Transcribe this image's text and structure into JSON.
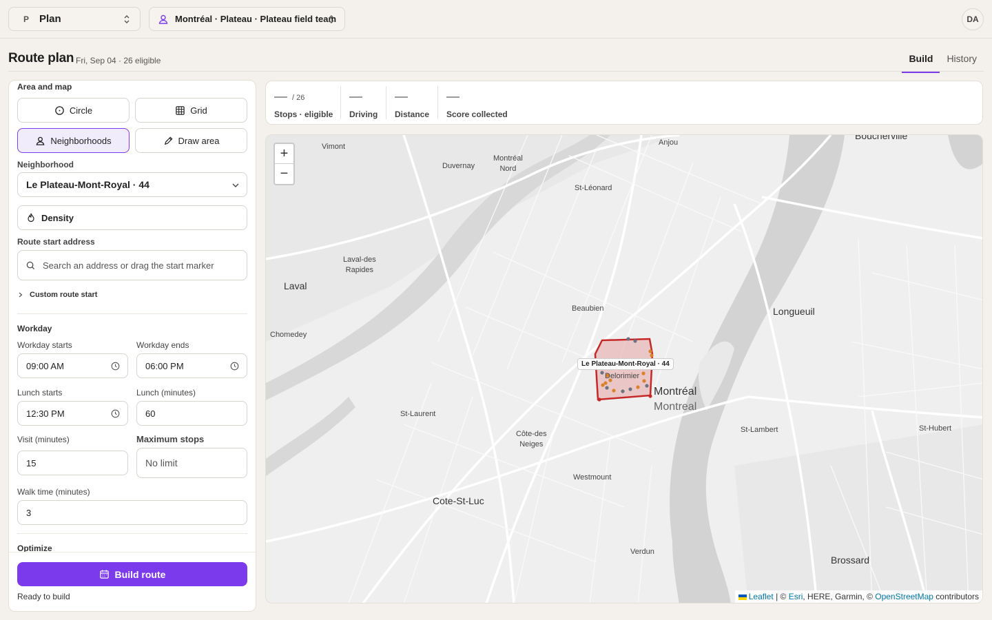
{
  "topbar": {
    "plan_badge": "P",
    "plan_label": "Plan",
    "team_label": "Montréal · Plateau · Plateau field team",
    "avatar": "DA"
  },
  "header": {
    "title": "Route plan",
    "subtitle": "Fri, Sep 04 · 26 eligible",
    "tabs": [
      {
        "label": "Build",
        "active": true
      },
      {
        "label": "History",
        "active": false
      }
    ]
  },
  "panel": {
    "area_label": "Area and map",
    "modes": {
      "circle": "Circle",
      "grid": "Grid",
      "neighborhoods": "Neighborhoods",
      "draw": "Draw area",
      "active": "neighborhoods"
    },
    "neighborhood_label": "Neighborhood",
    "neighborhood_value": "Le Plateau-Mont-Royal · 44",
    "density_label": "Density",
    "start_label": "Route start address",
    "start_placeholder": "Search an address or drag the start marker",
    "custom_start": "Custom route start",
    "workday_label": "Workday",
    "workday_starts_label": "Workday starts",
    "workday_starts": "09:00  AM",
    "workday_ends_label": "Workday ends",
    "workday_ends": "06:00  PM",
    "lunch_starts_label": "Lunch starts",
    "lunch_starts": "12:30  PM",
    "lunch_minutes_label": "Lunch (minutes)",
    "lunch_minutes": "60",
    "visit_label": "Visit (minutes)",
    "visit_value": "15",
    "max_stops_label": "Maximum stops",
    "max_stops_placeholder": "No limit",
    "walk_label": "Walk time (minutes)",
    "walk_value": "3",
    "optimize_label": "Optimize",
    "build_button": "Build route",
    "status": "Ready to build"
  },
  "stats": [
    {
      "value": "—",
      "of": "/ 26",
      "label": "Stops · eligible"
    },
    {
      "value": "—",
      "label": "Driving"
    },
    {
      "value": "—",
      "label": "Distance"
    },
    {
      "value": "—",
      "label": "Score collected"
    }
  ],
  "map": {
    "zoom_in": "+",
    "zoom_out": "−",
    "places": {
      "vimont": "Vimont",
      "duvernay": "Duvernay",
      "montreal_nord": "Montréal\nNord",
      "anjou": "Anjou",
      "boucherville": "Boucherville",
      "st_leonard": "St-Léonard",
      "laval_des_rapides": "Laval-des\nRapides",
      "laval": "Laval",
      "longueuil": "Longueuil",
      "beaubien": "Beaubien",
      "chomedey": "Chomedey",
      "delorimier": "Delorimier",
      "montreal": "Montréal",
      "montreal_en": "Montreal",
      "st_laurent": "St-Laurent",
      "cote_des_neiges": "Côte-des\nNeiges",
      "st_lambert": "St-Lambert",
      "st_hubert": "St-Hubert",
      "westmount": "Westmount",
      "cote_st_luc": "Cote-St-Luc",
      "verdun": "Verdun",
      "brossard": "Brossard"
    },
    "neighborhood_tooltip": "Le Plateau-Mont-Royal · 44",
    "attribution": {
      "leaflet": "Leaflet",
      "sep": " | © ",
      "esri": "Esri",
      "rest": ", HERE, Garmin, © ",
      "osm": "OpenStreetMap",
      "tail": " contributors"
    },
    "colors": {
      "polygon_stroke": "#c62828",
      "polygon_fill": "#e8a4a4",
      "marker_orange": "#d9822b",
      "marker_gray": "#6b7280",
      "water": "#d3d3d3",
      "road": "#ffffff"
    }
  },
  "colors": {
    "accent": "#7c3aed",
    "background": "#f4f1ec"
  }
}
